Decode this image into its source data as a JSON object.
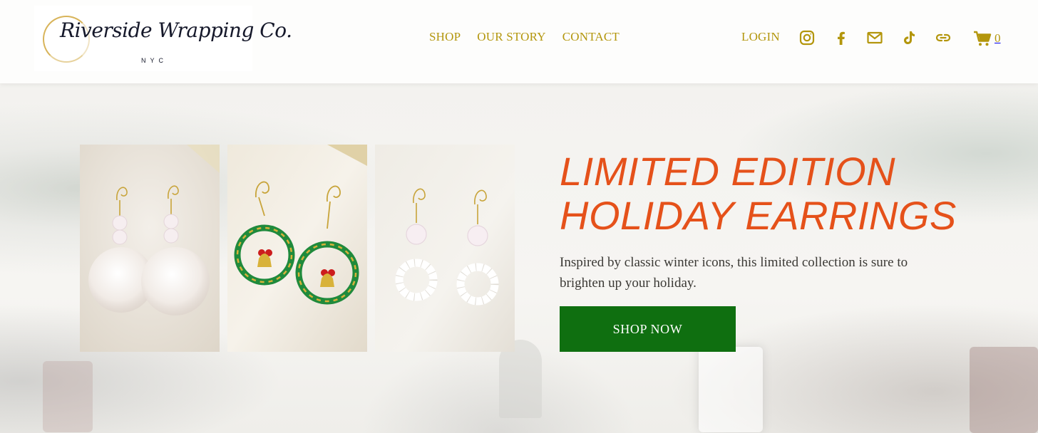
{
  "brand": {
    "logo_script": "Riverside Wrapping Co.",
    "logo_sub": "NYC"
  },
  "nav": {
    "items": [
      {
        "label": "SHOP"
      },
      {
        "label": "OUR STORY"
      },
      {
        "label": "CONTACT"
      }
    ],
    "login_label": "LOGIN",
    "socials": [
      "instagram-icon",
      "facebook-icon",
      "email-icon",
      "tiktok-icon",
      "link-icon"
    ],
    "cart_count": "0"
  },
  "hero": {
    "headline_line1": "LIMITED EDITION",
    "headline_line2": "HOLIDAY EARRINGS",
    "subcopy": "Inspired by classic winter icons, this limited collection is sure to brighten up your holiday.",
    "cta_label": "SHOP NOW"
  },
  "colors": {
    "accent_gold": "#b3960c",
    "headline_orange": "#e5511a",
    "cta_green": "#0f6f10"
  }
}
